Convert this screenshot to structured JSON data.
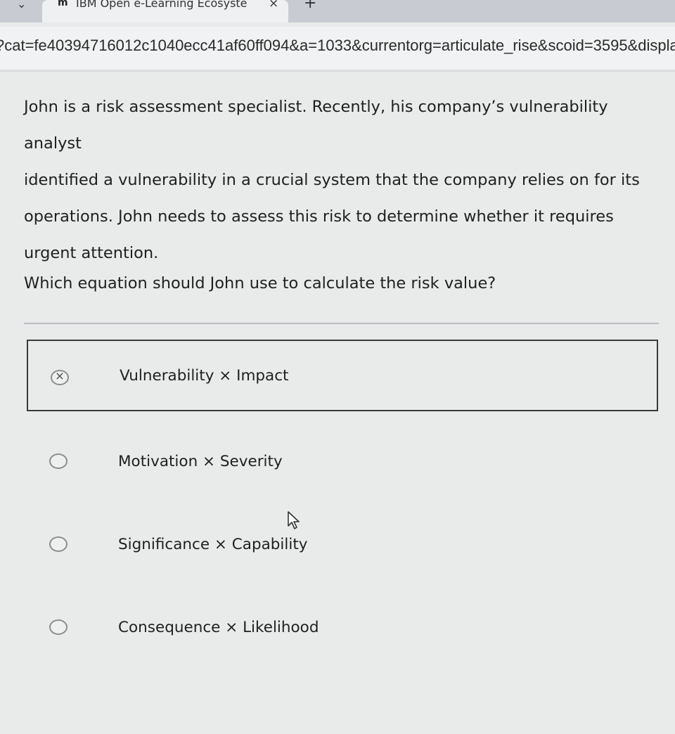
{
  "browser": {
    "tab_title": "IBM Open e-Learning Ecosyste",
    "tab_close": "×",
    "new_tab": "+",
    "url": "?cat=fe40394716012c1040ecc41af60ff094&a=1033&currentorg=articulate_rise&scoid=3595&display="
  },
  "question": {
    "scenario_lines": [
      "John is a risk assessment specialist. Recently, his company’s vulnerability analyst",
      "identified a vulnerability in a crucial system that the company relies on for its",
      "operations. John needs to assess this risk to determine whether it requires",
      "urgent attention."
    ],
    "prompt": "Which equation should John use to calculate the risk value?"
  },
  "options": [
    {
      "label": "Vulnerability × Impact",
      "state": "selected-incorrect"
    },
    {
      "label": "Motivation × Severity",
      "state": "unselected"
    },
    {
      "label": "Significance × Capability",
      "state": "unselected"
    },
    {
      "label": "Consequence × Likelihood",
      "state": "unselected"
    }
  ]
}
